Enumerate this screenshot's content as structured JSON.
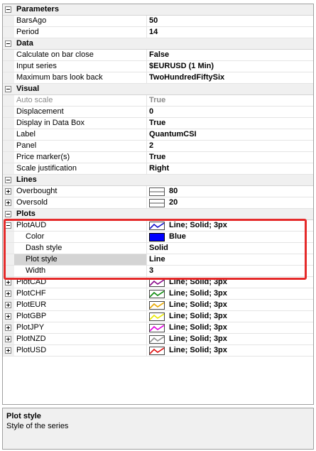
{
  "categories": {
    "parameters": "Parameters",
    "data": "Data",
    "visual": "Visual",
    "lines": "Lines",
    "plots": "Plots"
  },
  "parameters": [
    {
      "name": "BarsAgo",
      "value": "50"
    },
    {
      "name": "Period",
      "value": "14"
    }
  ],
  "data": [
    {
      "name": "Calculate on bar close",
      "value": "False"
    },
    {
      "name": "Input series",
      "value": "$EURUSD (1 Min)"
    },
    {
      "name": "Maximum bars look back",
      "value": "TwoHundredFiftySix"
    }
  ],
  "visual": [
    {
      "name": "Auto scale",
      "value": "True"
    },
    {
      "name": "Displacement",
      "value": "0"
    },
    {
      "name": "Display in Data Box",
      "value": "True"
    },
    {
      "name": "Label",
      "value": "QuantumCSI"
    },
    {
      "name": "Panel",
      "value": "2"
    },
    {
      "name": "Price marker(s)",
      "value": "True"
    },
    {
      "name": "Scale justification",
      "value": "Right"
    }
  ],
  "lines": [
    {
      "name": "Overbought",
      "value": "80"
    },
    {
      "name": "Oversold",
      "value": "20"
    }
  ],
  "plot_aud": {
    "name": "PlotAUD",
    "value": "Line; Solid; 3px",
    "color": "#1515cc",
    "children": [
      {
        "name": "Color",
        "value": "Blue",
        "swatch": "#0000ff"
      },
      {
        "name": "Dash style",
        "value": "Solid"
      },
      {
        "name": "Plot style",
        "value": "Line"
      },
      {
        "name": "Width",
        "value": "3"
      }
    ]
  },
  "plots": [
    {
      "name": "PlotCAD",
      "value": "Line; Solid; 3px",
      "color": "#8b0a8b"
    },
    {
      "name": "PlotCHF",
      "value": "Line; Solid; 3px",
      "color": "#0b8a0b"
    },
    {
      "name": "PlotEUR",
      "value": "Line; Solid; 3px",
      "color": "#e8a800"
    },
    {
      "name": "PlotGBP",
      "value": "Line; Solid; 3px",
      "color": "#e8e800"
    },
    {
      "name": "PlotJPY",
      "value": "Line; Solid; 3px",
      "color": "#e000e0"
    },
    {
      "name": "PlotNZD",
      "value": "Line; Solid; 3px",
      "color": "#909090"
    },
    {
      "name": "PlotUSD",
      "value": "Line; Solid; 3px",
      "color": "#e01010"
    }
  ],
  "description": {
    "title": "Plot style",
    "text": "Style of the series"
  },
  "highlight_color": "#e52a2a"
}
